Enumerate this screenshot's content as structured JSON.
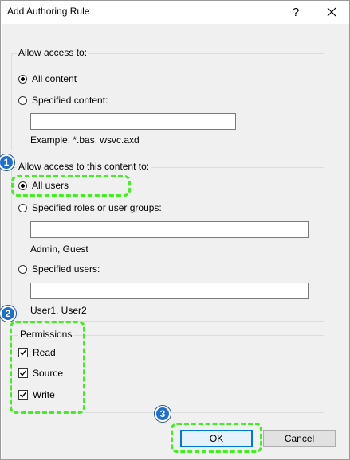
{
  "window": {
    "title": "Add Authoring Rule",
    "help_label": "?"
  },
  "allow_access": {
    "label": "Allow access to:",
    "all_content": "All content",
    "specified_content": "Specified content:",
    "content_value": "",
    "content_example": "Example: *.bas, wsvc.axd"
  },
  "allow_users": {
    "label": "Allow access to this content to:",
    "all_users": "All users",
    "roles": "Specified roles or user groups:",
    "roles_value": "",
    "roles_example": "Admin, Guest",
    "users": "Specified users:",
    "users_value": "",
    "users_example": "User1, User2"
  },
  "permissions": {
    "label": "Permissions",
    "read": "Read",
    "source": "Source",
    "write": "Write"
  },
  "buttons": {
    "ok": "OK",
    "cancel": "Cancel"
  },
  "callouts": [
    "1",
    "2",
    "3"
  ],
  "colors": {
    "highlight": "#44ee22",
    "badge": "#1f6ed4",
    "default_button_border": "#0078d7"
  }
}
